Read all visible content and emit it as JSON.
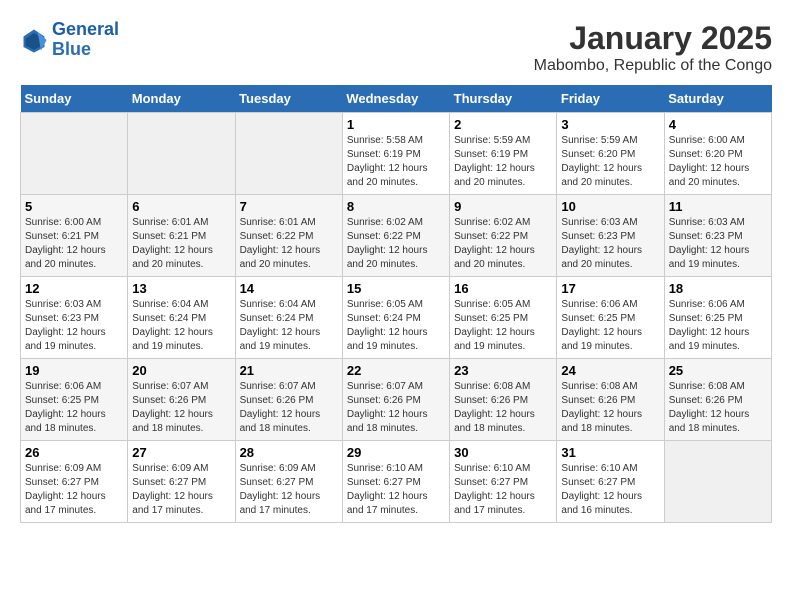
{
  "header": {
    "logo_line1": "General",
    "logo_line2": "Blue",
    "title": "January 2025",
    "subtitle": "Mabombo, Republic of the Congo"
  },
  "days_of_week": [
    "Sunday",
    "Monday",
    "Tuesday",
    "Wednesday",
    "Thursday",
    "Friday",
    "Saturday"
  ],
  "weeks": [
    [
      {
        "num": "",
        "info": ""
      },
      {
        "num": "",
        "info": ""
      },
      {
        "num": "",
        "info": ""
      },
      {
        "num": "1",
        "info": "Sunrise: 5:58 AM\nSunset: 6:19 PM\nDaylight: 12 hours\nand 20 minutes."
      },
      {
        "num": "2",
        "info": "Sunrise: 5:59 AM\nSunset: 6:19 PM\nDaylight: 12 hours\nand 20 minutes."
      },
      {
        "num": "3",
        "info": "Sunrise: 5:59 AM\nSunset: 6:20 PM\nDaylight: 12 hours\nand 20 minutes."
      },
      {
        "num": "4",
        "info": "Sunrise: 6:00 AM\nSunset: 6:20 PM\nDaylight: 12 hours\nand 20 minutes."
      }
    ],
    [
      {
        "num": "5",
        "info": "Sunrise: 6:00 AM\nSunset: 6:21 PM\nDaylight: 12 hours\nand 20 minutes."
      },
      {
        "num": "6",
        "info": "Sunrise: 6:01 AM\nSunset: 6:21 PM\nDaylight: 12 hours\nand 20 minutes."
      },
      {
        "num": "7",
        "info": "Sunrise: 6:01 AM\nSunset: 6:22 PM\nDaylight: 12 hours\nand 20 minutes."
      },
      {
        "num": "8",
        "info": "Sunrise: 6:02 AM\nSunset: 6:22 PM\nDaylight: 12 hours\nand 20 minutes."
      },
      {
        "num": "9",
        "info": "Sunrise: 6:02 AM\nSunset: 6:22 PM\nDaylight: 12 hours\nand 20 minutes."
      },
      {
        "num": "10",
        "info": "Sunrise: 6:03 AM\nSunset: 6:23 PM\nDaylight: 12 hours\nand 20 minutes."
      },
      {
        "num": "11",
        "info": "Sunrise: 6:03 AM\nSunset: 6:23 PM\nDaylight: 12 hours\nand 19 minutes."
      }
    ],
    [
      {
        "num": "12",
        "info": "Sunrise: 6:03 AM\nSunset: 6:23 PM\nDaylight: 12 hours\nand 19 minutes."
      },
      {
        "num": "13",
        "info": "Sunrise: 6:04 AM\nSunset: 6:24 PM\nDaylight: 12 hours\nand 19 minutes."
      },
      {
        "num": "14",
        "info": "Sunrise: 6:04 AM\nSunset: 6:24 PM\nDaylight: 12 hours\nand 19 minutes."
      },
      {
        "num": "15",
        "info": "Sunrise: 6:05 AM\nSunset: 6:24 PM\nDaylight: 12 hours\nand 19 minutes."
      },
      {
        "num": "16",
        "info": "Sunrise: 6:05 AM\nSunset: 6:25 PM\nDaylight: 12 hours\nand 19 minutes."
      },
      {
        "num": "17",
        "info": "Sunrise: 6:06 AM\nSunset: 6:25 PM\nDaylight: 12 hours\nand 19 minutes."
      },
      {
        "num": "18",
        "info": "Sunrise: 6:06 AM\nSunset: 6:25 PM\nDaylight: 12 hours\nand 19 minutes."
      }
    ],
    [
      {
        "num": "19",
        "info": "Sunrise: 6:06 AM\nSunset: 6:25 PM\nDaylight: 12 hours\nand 18 minutes."
      },
      {
        "num": "20",
        "info": "Sunrise: 6:07 AM\nSunset: 6:26 PM\nDaylight: 12 hours\nand 18 minutes."
      },
      {
        "num": "21",
        "info": "Sunrise: 6:07 AM\nSunset: 6:26 PM\nDaylight: 12 hours\nand 18 minutes."
      },
      {
        "num": "22",
        "info": "Sunrise: 6:07 AM\nSunset: 6:26 PM\nDaylight: 12 hours\nand 18 minutes."
      },
      {
        "num": "23",
        "info": "Sunrise: 6:08 AM\nSunset: 6:26 PM\nDaylight: 12 hours\nand 18 minutes."
      },
      {
        "num": "24",
        "info": "Sunrise: 6:08 AM\nSunset: 6:26 PM\nDaylight: 12 hours\nand 18 minutes."
      },
      {
        "num": "25",
        "info": "Sunrise: 6:08 AM\nSunset: 6:26 PM\nDaylight: 12 hours\nand 18 minutes."
      }
    ],
    [
      {
        "num": "26",
        "info": "Sunrise: 6:09 AM\nSunset: 6:27 PM\nDaylight: 12 hours\nand 17 minutes."
      },
      {
        "num": "27",
        "info": "Sunrise: 6:09 AM\nSunset: 6:27 PM\nDaylight: 12 hours\nand 17 minutes."
      },
      {
        "num": "28",
        "info": "Sunrise: 6:09 AM\nSunset: 6:27 PM\nDaylight: 12 hours\nand 17 minutes."
      },
      {
        "num": "29",
        "info": "Sunrise: 6:10 AM\nSunset: 6:27 PM\nDaylight: 12 hours\nand 17 minutes."
      },
      {
        "num": "30",
        "info": "Sunrise: 6:10 AM\nSunset: 6:27 PM\nDaylight: 12 hours\nand 17 minutes."
      },
      {
        "num": "31",
        "info": "Sunrise: 6:10 AM\nSunset: 6:27 PM\nDaylight: 12 hours\nand 16 minutes."
      },
      {
        "num": "",
        "info": ""
      }
    ]
  ]
}
